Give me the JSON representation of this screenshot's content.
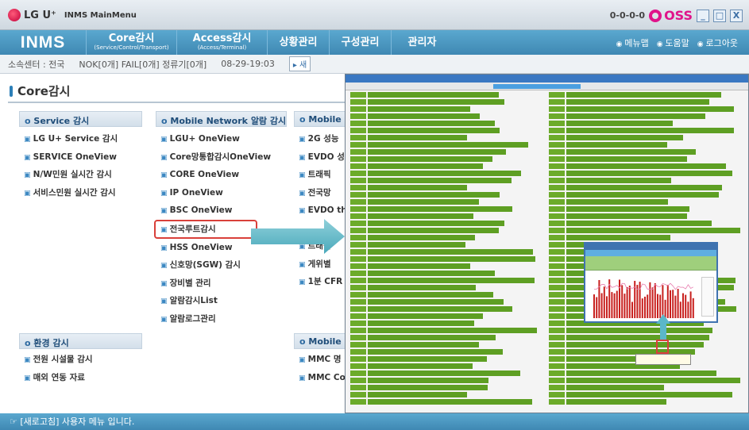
{
  "window": {
    "brand": "LG U⁺",
    "title": "INMS MainMenu",
    "version": "0-0-0-0",
    "oss_label": "OSS",
    "controls": [
      "_",
      "□",
      "X"
    ]
  },
  "nav": {
    "brand": "INMS",
    "items": [
      {
        "main": "Core감시",
        "sub": "(Service/Control/Transport)"
      },
      {
        "main": "Access감시",
        "sub": "(Access/Terminal)"
      },
      {
        "main": "상황관리",
        "sub": ""
      },
      {
        "main": "구성관리",
        "sub": ""
      },
      {
        "main": "관리자",
        "sub": ""
      }
    ],
    "right": [
      "메뉴맵",
      "도움말",
      "로그아웃"
    ]
  },
  "status": {
    "center": "소속센터 : 전국",
    "counts": "NOK[0개]  FAIL[0개]  정류기[0개]",
    "time": "08-29-19:03",
    "refresh": "▸ 새"
  },
  "page_title": "Core감시",
  "columns": [
    {
      "header": "Service 감시",
      "items": [
        "LG U+ Service 감시",
        "SERVICE OneView",
        "N/W민원 실시간 감시",
        "서비스민원 실시간 감시"
      ]
    },
    {
      "header": "Mobile Network 알람 감시",
      "items": [
        "LGU+ OneView",
        "Core망통합감시OneView",
        "CORE OneView",
        "IP OneView",
        "BSC OneView",
        "전국루트감시",
        "HSS OneView",
        "신호망(SGW) 감시",
        "장비별 관리",
        "알람감시List",
        "알람로그관리"
      ]
    },
    {
      "header": "Mobile N",
      "items": [
        "2G 성능",
        "EVDO 성",
        "트래픽",
        "전국망",
        "EVDO th",
        "",
        "트래픽",
        "게위별",
        "1분 CFR"
      ]
    },
    {
      "header": "환경 감시",
      "items": [
        "전원 시설물 감시",
        "매외 연동 자료"
      ]
    },
    {
      "header": "Mobile N",
      "items": [
        "MMC 명",
        "MMC Co"
      ]
    }
  ],
  "highlighted_item": "전국루트감시",
  "bottom_message": "[새로고침] 사용자 메뉴 입니다."
}
